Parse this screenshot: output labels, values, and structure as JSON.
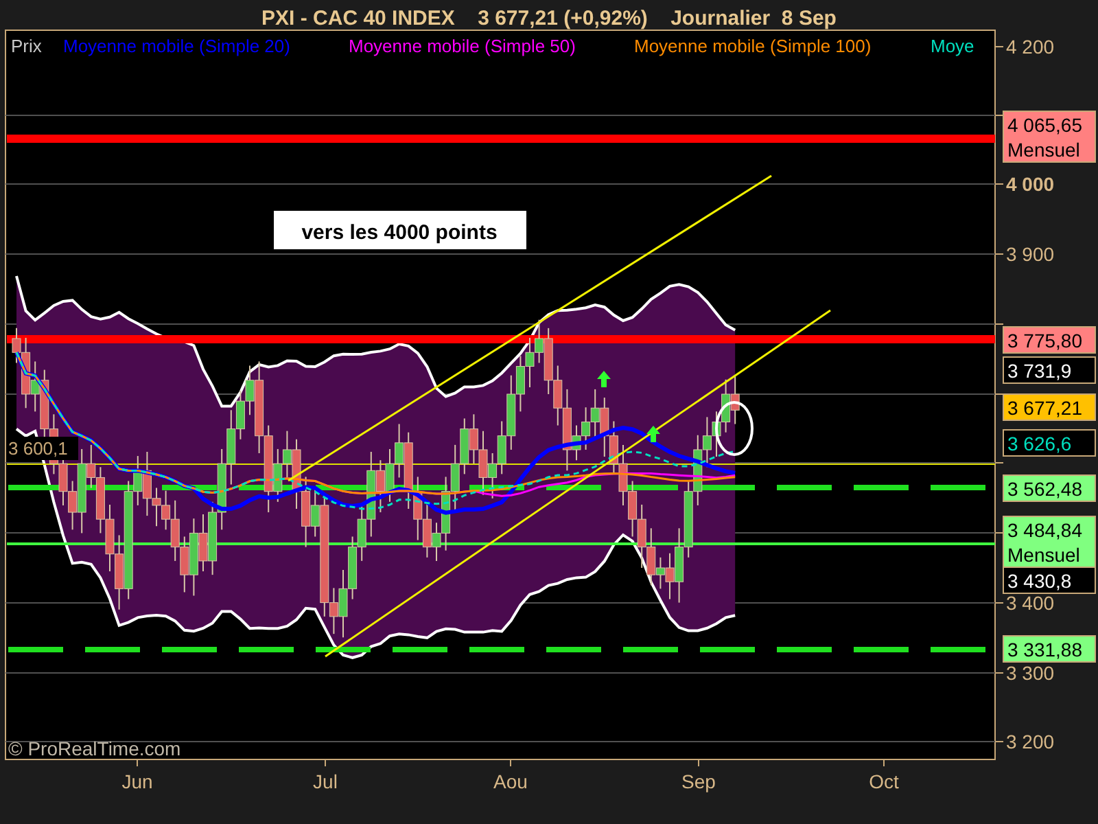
{
  "title": "PXI - CAC 40 INDEX    3 677,21 (+0,92%)    Journalier  8 Sep",
  "legend": [
    {
      "text": "Prix",
      "color": "#c8c8c8"
    },
    {
      "text": "Moyenne mobile (Simple 20)",
      "color": "#0000ff"
    },
    {
      "text": "Moyenne mobile (Simple 50)",
      "color": "#ff00ff"
    },
    {
      "text": "Moyenne mobile (Simple 100)",
      "color": "#ff8c00"
    },
    {
      "text": "Moye",
      "color": "#00e0c0"
    }
  ],
  "annotation": "vers les 4000 points",
  "inline_level": "3 600,1",
  "price_labels": [
    {
      "kind": "solid-level",
      "text": "4 065,65",
      "note": "Mensuel",
      "color": "#ff8080"
    },
    {
      "kind": "solid-level",
      "text": "3 775,80",
      "color": "#ff8080"
    },
    {
      "kind": "marker",
      "text": "3 731,9",
      "color": "#ffffff"
    },
    {
      "kind": "price",
      "text": "3 677,21",
      "color": "#ffc000"
    },
    {
      "kind": "marker",
      "text": "3 626,6",
      "color": "#00e0c0"
    },
    {
      "kind": "dashed-level",
      "text": "3 562,48",
      "color": "#80ff80"
    },
    {
      "kind": "solid-level",
      "text": "3 484,84",
      "note": "Mensuel",
      "color": "#80ff80"
    },
    {
      "kind": "marker",
      "text": "3 430,8",
      "color": "#ffffff"
    },
    {
      "kind": "dashed-level",
      "text": "3 331,88",
      "color": "#80ff80"
    }
  ],
  "y_axis": [
    {
      "text": "4 200",
      "bold": false
    },
    {
      "text": "4 000",
      "bold": true
    },
    {
      "text": "3 900",
      "bold": false
    },
    {
      "text": "3 400",
      "bold": false
    },
    {
      "text": "3 300",
      "bold": false
    },
    {
      "text": "3 200",
      "bold": false
    }
  ],
  "x_axis": [
    "Jun",
    "Jul",
    "Aou",
    "Sep",
    "Oct"
  ],
  "credit": "© ProRealTime.com"
}
